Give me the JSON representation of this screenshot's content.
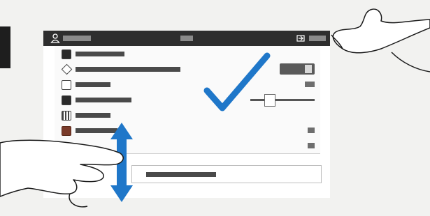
{
  "illustration": {
    "title": "",
    "icons": [
      "user-icon",
      "check-mark-icon",
      "scroll-arrow-icon",
      "hand-icon"
    ]
  },
  "device": {
    "topbar": {
      "user_icon": "user-icon",
      "login_icon": "login-icon"
    },
    "rows": [
      {
        "icon": "app-icon",
        "style": "dark",
        "control": "none"
      },
      {
        "icon": "diamond-icon",
        "style": "diamond",
        "control": "toggle"
      },
      {
        "icon": "app-icon",
        "style": "plain",
        "control": "label"
      },
      {
        "icon": "app-icon",
        "style": "dark",
        "control": "slider"
      },
      {
        "icon": "grid-icon",
        "style": "grid",
        "control": "none"
      },
      {
        "icon": "app-icon",
        "style": "brown",
        "control": "end"
      },
      {
        "icon": "none",
        "style": "blank",
        "control": "end"
      }
    ]
  },
  "colors": {
    "accent_blue": "#1f77c9",
    "topbar": "#2e2e2e"
  }
}
